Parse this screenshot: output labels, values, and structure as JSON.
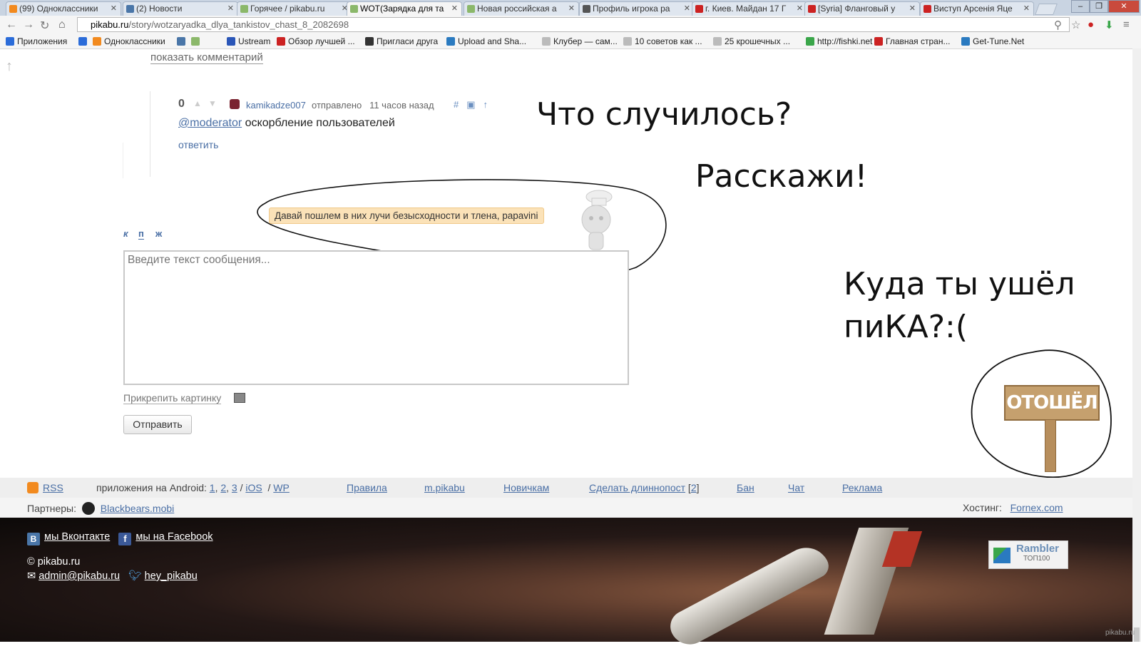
{
  "browser": {
    "tabs": [
      {
        "title": "(99) Одноклассники",
        "favicon": "odnoklassniki-icon",
        "color": "#f28a1f"
      },
      {
        "title": "(2) Новости",
        "favicon": "vk-icon",
        "color": "#4a76a8"
      },
      {
        "title": "Горячее / pikabu.ru",
        "favicon": "pikabu-icon",
        "color": "#8bb86a"
      },
      {
        "title": "WOT(Зарядка для та",
        "favicon": "pikabu-icon",
        "color": "#8bb86a"
      },
      {
        "title": "Новая российская а",
        "favicon": "pikabu-icon",
        "color": "#8bb86a"
      },
      {
        "title": "Профиль игрока ра",
        "favicon": "wot-icon",
        "color": "#555555"
      },
      {
        "title": "г. Киев. Майдан 17 Г",
        "favicon": "youtube-icon",
        "color": "#cc2222"
      },
      {
        "title": "[Syria] Фланговый у",
        "favicon": "youtube-icon",
        "color": "#cc2222"
      },
      {
        "title": "Виступ Арсенія Яце",
        "favicon": "youtube-icon",
        "color": "#cc2222"
      }
    ],
    "active_tab_index": 3,
    "url_host": "pikabu.ru",
    "url_path": "/story/wotzaryadka_dlya_tankistov_chast_8_2082698",
    "bookmarks": [
      {
        "label": "Приложения",
        "color": "#2b6cd9"
      },
      {
        "label": "",
        "color": "#2b6cd9"
      },
      {
        "label": "Одноклассники",
        "color": "#f28a1f"
      },
      {
        "label": "",
        "color": "#4a76a8"
      },
      {
        "label": "",
        "color": "#8bb86a"
      },
      {
        "label": "Ustream",
        "color": "#2a56b8"
      },
      {
        "label": "Обзор лучшей ...",
        "color": "#cc2222"
      },
      {
        "label": "Пригласи друга",
        "color": "#333333"
      },
      {
        "label": "Upload and Sha...",
        "color": "#2a7ac0"
      },
      {
        "label": "Клубер — сам...",
        "color": "#bbbbbb"
      },
      {
        "label": "10 советов как ...",
        "color": "#bbbbbb"
      },
      {
        "label": "25 крошечных ...",
        "color": "#bbbbbb"
      },
      {
        "label": "http://fishki.net",
        "color": "#3aa64a"
      },
      {
        "label": "Главная стран...",
        "color": "#cc2222"
      },
      {
        "label": "Get-Tune.Net",
        "color": "#2a7ac0"
      }
    ]
  },
  "page": {
    "show_comment": "показать комментарий",
    "comment": {
      "rating": "0",
      "author": "kamikadze007",
      "sent_label": "отправлено",
      "time": "11 часов назад",
      "mention": "@moderator",
      "text": "оскорбление пользователей",
      "reply": "ответить"
    },
    "hint": "Давай пошлем в них лучи безысходности и тлена, papavini",
    "format_buttons": [
      "к",
      "п",
      "ж"
    ],
    "textarea_placeholder": "Введите текст сообщения...",
    "attach_label": "Прикрепить картинку",
    "send_label": "Отправить",
    "overlay": {
      "line1": "Что случилось?",
      "line2": "Расскажи!",
      "line3a": "Куда ты ушёл",
      "line3b": "пиКА?:(",
      "sign": "ОТОШЁЛ"
    }
  },
  "footer": {
    "rss": "RSS",
    "android_label": "приложения на Android:",
    "android_links": [
      "1",
      "2",
      "3"
    ],
    "ios": "iOS",
    "wp": "WP",
    "rules": "Правила",
    "mobile": "m.pikabu",
    "newbies": "Новичкам",
    "longpost": "Сделать длиннопост",
    "longpost_count": "2",
    "ban": "Бан",
    "chat": "Чат",
    "ads": "Реклама",
    "partners_label": "Партнеры:",
    "partner": "Blackbears.mobi",
    "hosting_label": "Хостинг:",
    "hosting": "Fornex.com",
    "vk": "мы Вконтакте",
    "facebook": "мы на Facebook",
    "copyright": "© pikabu.ru",
    "email": "admin@pikabu.ru",
    "twitter": "hey_pikabu",
    "rambler_title": "Rambler",
    "rambler_sub": "ТОП100",
    "watermark": "pikabu.ru"
  }
}
